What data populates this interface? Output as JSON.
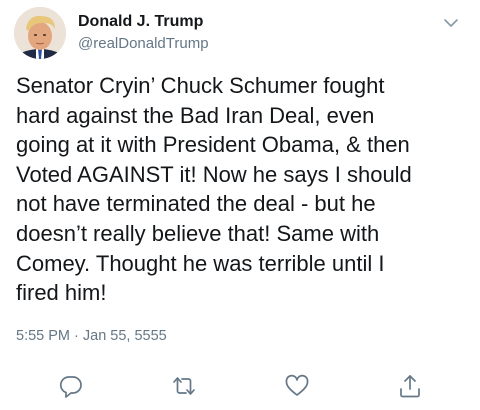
{
  "user": {
    "display_name": "Donald J. Trump",
    "handle": "@realDonaldTrump",
    "avatar_icon": "profile-photo"
  },
  "tweet": {
    "text_lines": [
      "Senator Cryin’ Chuck Schumer fought",
      "hard against the Bad Iran Deal, even",
      "going at it with President Obama, & then",
      "Voted AGAINST it! Now he says I should",
      "not have terminated the deal - but he",
      "doesn’t really believe that! Same with",
      "Comey. Thought he was terrible until I",
      "fired him!"
    ],
    "timestamp": "5:55 PM · Jan 55, 5555"
  },
  "actions": {
    "reply_icon": "reply-icon",
    "retweet_icon": "retweet-icon",
    "like_icon": "heart-icon",
    "share_icon": "share-icon",
    "more_icon": "chevron-down-icon"
  },
  "colors": {
    "text": "#14171a",
    "secondary": "#657786",
    "icon": "#657786"
  }
}
